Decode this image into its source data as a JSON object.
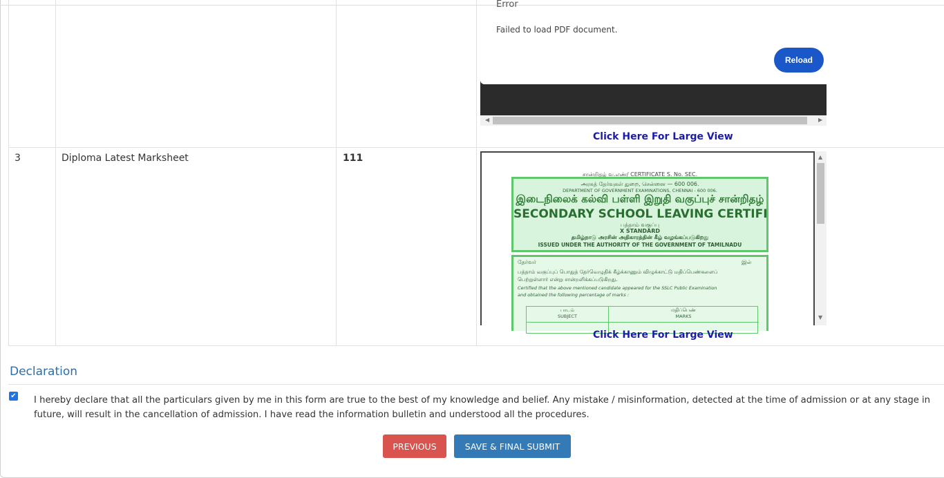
{
  "pdf_error": {
    "title": "Error",
    "message": "Failed to load PDF document.",
    "reload_label": "Reload"
  },
  "rows": [
    {
      "sno": "",
      "document": "",
      "value": "",
      "link_label": "Click Here For Large View"
    },
    {
      "sno": "3",
      "document": "Diploma Latest Marksheet",
      "value": "111",
      "link_label": "Click Here For Large View"
    }
  ],
  "certificate": {
    "serial": "சான்றிதழ் வ.எண்/ CERTIFICATE S. No. SEC.",
    "dept_tamil": "அரசுத் தேர்வுகள் துறை, சென்னை — 600 006.",
    "dept_english": "DEPARTMENT OF GOVERNMENT EXAMINATIONS, CHENNAI - 600 006.",
    "heading_tamil": "இடைநிலைக் கல்வி பள்ளி இறுதி வகுப்புச் சான்றிதழ்",
    "heading_english": "SECONDARY SCHOOL LEAVING CERTIFICATE",
    "std_tamil": "பத்தாம் வகுப்பு",
    "std_english": "X STANDARD",
    "authority_tamil": "தமிழ்நாடு அரசின் அதிகாரத்தின் கீழ் வழங்கப்படுகிறது",
    "authority_english": "ISSUED UNDER THE AUTHORITY OF THE GOVERNMENT OF TAMILNADU",
    "body_line1_left": "தேர்வர்",
    "body_line1_right": "இல்",
    "body_line2": "பத்தாம் வகுப்புப் பொதுத் தேர்வெழுதிக் கீழ்க்காணும் விழுக்காட்டு மதிப்பெண்களைப்",
    "body_line3": "பெற்றுள்ளார் என்று சான்றளிக்கப்படுகிறது.",
    "body_line4": "Certified that the above mentioned candidate appeared for the SSLC Public Examination",
    "body_line5": "and obtained the following percentage of marks :",
    "col_subject_tamil": "பாடம்",
    "col_subject": "SUBJECT",
    "col_marks_tamil": "மதிப்பெண்",
    "col_marks": "MARKS"
  },
  "declaration": {
    "title": "Declaration",
    "checked": true,
    "text": "I hereby declare that all the particulars given by me in this form are true to the best of my knowledge and belief. Any mistake / misinformation, detected at the time of admission or at any stage in future, will result in the cancellation of admission. I have read the information bulletin and understood all the procedures."
  },
  "buttons": {
    "previous": "PREVIOUS",
    "submit": "SAVE & FINAL SUBMIT"
  },
  "colors": {
    "accent_blue": "#337ab7",
    "danger_red": "#d9534f",
    "reload_blue": "#1a57c9",
    "link_blue": "#1b1ba8",
    "certificate_green": "#5fc66b"
  }
}
